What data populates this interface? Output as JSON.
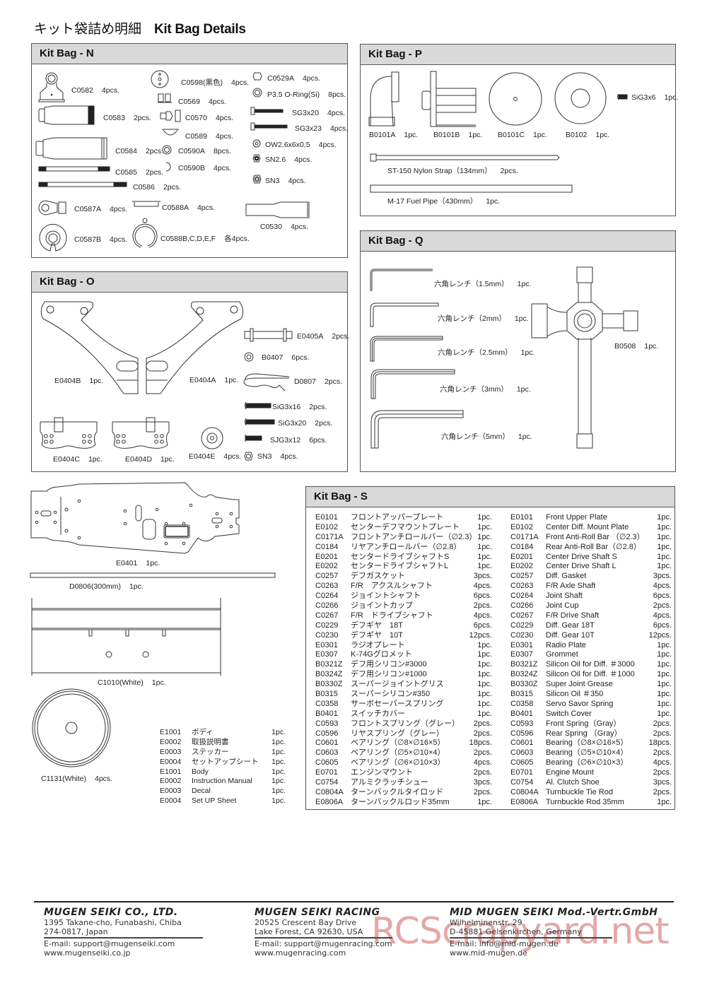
{
  "page": {
    "title_ja": "キット袋詰め明細",
    "title_en": "Kit Bag Details"
  },
  "bag_n": {
    "title": "Kit  Bag - N",
    "items": [
      {
        "code": "C0582",
        "qty": "4pcs."
      },
      {
        "code": "C0583",
        "qty": "2pcs."
      },
      {
        "code": "C0584",
        "qty": "2pcs."
      },
      {
        "code": "C0585",
        "qty": "2pcs."
      },
      {
        "code": "C0586",
        "qty": "2pcs."
      },
      {
        "code": "C0587A",
        "qty": "4pcs."
      },
      {
        "code": "C0587B",
        "qty": "4pcs."
      },
      {
        "code": "C0598(黒色)",
        "qty": "4pcs."
      },
      {
        "code": "C0569",
        "qty": "4pcs."
      },
      {
        "code": "C0570",
        "qty": "4pcs."
      },
      {
        "code": "C0589",
        "qty": "4pcs."
      },
      {
        "code": "C0590A",
        "qty": "8pcs."
      },
      {
        "code": "C0590B",
        "qty": "4pcs."
      },
      {
        "code": "C0588A",
        "qty": "4pcs."
      },
      {
        "code": "C0588B,C,D,E,F",
        "qty": "各4pcs."
      },
      {
        "code": "C0529A",
        "qty": "4pcs."
      },
      {
        "code": "P3.5 O-Ring(Si)",
        "qty": "8pcs."
      },
      {
        "code": "SG3x20",
        "qty": "4pcs."
      },
      {
        "code": "SG3x23",
        "qty": "4pcs."
      },
      {
        "code": "OW2.6x6x0.5",
        "qty": "4pcs."
      },
      {
        "code": "SN2.6",
        "qty": "4pcs."
      },
      {
        "code": "SN3",
        "qty": "4pcs."
      },
      {
        "code": "C0530",
        "qty": "4pcs."
      }
    ]
  },
  "bag_p": {
    "title": "Kit  Bag - P",
    "items": [
      {
        "code": "B0101A",
        "qty": "1pc."
      },
      {
        "code": "B0101B",
        "qty": "1pc."
      },
      {
        "code": "B0101C",
        "qty": "1pc."
      },
      {
        "code": "B0102",
        "qty": "1pc."
      },
      {
        "code": "SiG3x6",
        "qty": "1pc."
      },
      {
        "code": "ST-150 Nylon Strap（134mm）",
        "qty": "2pcs."
      },
      {
        "code": "M-17 Fuel Pipe（430mm）",
        "qty": "1pc."
      }
    ]
  },
  "bag_o": {
    "title": "Kit  Bag - O",
    "items": [
      {
        "code": "E0404B",
        "qty": "1pc."
      },
      {
        "code": "E0404A",
        "qty": "1pc."
      },
      {
        "code": "E0405A",
        "qty": "2pcs."
      },
      {
        "code": "B0407",
        "qty": "6pcs."
      },
      {
        "code": "D0807",
        "qty": "2pcs."
      },
      {
        "code": "SiG3x16",
        "qty": "2pcs."
      },
      {
        "code": "SiG3x20",
        "qty": "2pcs."
      },
      {
        "code": "SJG3x12",
        "qty": "6pcs."
      },
      {
        "code": "E0404C",
        "qty": "1pc."
      },
      {
        "code": "E0404D",
        "qty": "1pc."
      },
      {
        "code": "E0404E",
        "qty": "4pcs."
      },
      {
        "code": "SN3",
        "qty": "4pcs."
      }
    ]
  },
  "bag_q": {
    "title": "Kit  Bag - Q",
    "items": [
      {
        "code": "六角レンチ（1.5mm）",
        "qty": "1pc."
      },
      {
        "code": "六角レンチ（2mm）",
        "qty": "1pc."
      },
      {
        "code": "六角レンチ（2.5mm）",
        "qty": "1pc."
      },
      {
        "code": "六角レンチ（3mm）",
        "qty": "1pc."
      },
      {
        "code": "六角レンチ（5mm）",
        "qty": "1pc."
      },
      {
        "code": "B0508",
        "qty": "1pc."
      }
    ]
  },
  "loose": {
    "items": [
      {
        "code": "E0401",
        "qty": "1pc."
      },
      {
        "code": "D0806(300mm)",
        "qty": "1pc."
      },
      {
        "code": "C1010(White)",
        "qty": "1pc."
      },
      {
        "code": "C1131(White)",
        "qty": "4pcs."
      }
    ],
    "misc_list": [
      {
        "code": "E1001",
        "name": "ボディ",
        "qty": "1pc."
      },
      {
        "code": "E0002",
        "name": "取扱説明書",
        "qty": "1pc."
      },
      {
        "code": "E0003",
        "name": "ステッカー",
        "qty": "1pc."
      },
      {
        "code": "E0004",
        "name": "セットアップシート",
        "qty": "1pc."
      },
      {
        "code": "E1001",
        "name": "Body",
        "qty": "1pc."
      },
      {
        "code": "E0002",
        "name": "Instruction Manual",
        "qty": "1pc."
      },
      {
        "code": "E0003",
        "name": "Decal",
        "qty": "1pc."
      },
      {
        "code": "E0004",
        "name": "Set UP Sheet",
        "qty": "1pc."
      }
    ]
  },
  "bag_s": {
    "title": "Kit  Bag - S",
    "ja": [
      {
        "code": "E0101",
        "name": "フロントアッパープレート",
        "qty": "1pc."
      },
      {
        "code": "E0102",
        "name": "センターデフマウントプレート",
        "qty": "1pc."
      },
      {
        "code": "C0171A",
        "name": "フロントアンチロールバー（∅2.3）",
        "qty": "1pc."
      },
      {
        "code": "C0184",
        "name": "リヤアンチロールバー（∅2.8）",
        "qty": "1pc."
      },
      {
        "code": "E0201",
        "name": "センタードライブシャフトS",
        "qty": "1pc."
      },
      {
        "code": "E0202",
        "name": "センタードライブシャフトL",
        "qty": "1pc."
      },
      {
        "code": "C0257",
        "name": "デフガスケット",
        "qty": "3pcs."
      },
      {
        "code": "C0263",
        "name": "F/R　アクスルシャフト",
        "qty": "4pcs."
      },
      {
        "code": "C0264",
        "name": "ジョイントシャフト",
        "qty": "6pcs."
      },
      {
        "code": "C0266",
        "name": "ジョイントカップ",
        "qty": "2pcs."
      },
      {
        "code": "C0267",
        "name": "F/R　ドライブシャフト",
        "qty": "4pcs."
      },
      {
        "code": "C0229",
        "name": "デフギヤ　18T",
        "qty": "6pcs."
      },
      {
        "code": "C0230",
        "name": "デフギヤ　10T",
        "qty": "12pcs."
      },
      {
        "code": "E0301",
        "name": "ラジオプレート",
        "qty": "1pc."
      },
      {
        "code": "E0307",
        "name": "K-74Gグロメット",
        "qty": "1pc."
      },
      {
        "code": "B0321Z",
        "name": "デフ用シリコン#3000",
        "qty": "1pc."
      },
      {
        "code": "B0324Z",
        "name": "デフ用シリコン#1000",
        "qty": "1pc."
      },
      {
        "code": "B0330Z",
        "name": "スーパージョイントグリス",
        "qty": "1pc."
      },
      {
        "code": "B0315",
        "name": "スーパーシリコン#350",
        "qty": "1pc."
      },
      {
        "code": "C0358",
        "name": "サーボセーバースプリング",
        "qty": "1pc."
      },
      {
        "code": "B0401",
        "name": "スイッチカバー",
        "qty": "1pc."
      },
      {
        "code": "C0593",
        "name": "フロントスプリング（グレー）",
        "qty": "2pcs."
      },
      {
        "code": "C0596",
        "name": "リヤスプリング（グレー）",
        "qty": "2pcs."
      },
      {
        "code": "C0601",
        "name": "ベアリング（∅8×∅16×5）",
        "qty": "18pcs."
      },
      {
        "code": "C0603",
        "name": "ベアリング（∅5×∅10×4）",
        "qty": "2pcs."
      },
      {
        "code": "C0605",
        "name": "ベアリング（∅6×∅10×3）",
        "qty": "4pcs."
      },
      {
        "code": "E0701",
        "name": "エンジンマウント",
        "qty": "2pcs."
      },
      {
        "code": "C0754",
        "name": "アルミクラッチシュー",
        "qty": "3pcs."
      },
      {
        "code": "C0804A",
        "name": "ターンバックルタイロッド",
        "qty": "2pcs."
      },
      {
        "code": "E0806A",
        "name": "ターンバックルロッド35mm",
        "qty": "1pc."
      }
    ],
    "en": [
      {
        "code": "E0101",
        "name": "Front Upper Plate",
        "qty": "1pc."
      },
      {
        "code": "E0102",
        "name": "Center Diff. Mount Plate",
        "qty": "1pc."
      },
      {
        "code": "C0171A",
        "name": "Front Anti-Roll Bar （∅2.3）",
        "qty": "1pc."
      },
      {
        "code": "C0184",
        "name": "Rear Anti-Roll Bar（∅2.8）",
        "qty": "1pc."
      },
      {
        "code": "E0201",
        "name": "Center Drive Shaft S",
        "qty": "1pc."
      },
      {
        "code": "E0202",
        "name": "Center Drive Shaft L",
        "qty": "1pc."
      },
      {
        "code": "C0257",
        "name": "Diff. Gasket",
        "qty": "3pcs."
      },
      {
        "code": "C0263",
        "name": "F/R Axle Shaft",
        "qty": "4pcs."
      },
      {
        "code": "C0264",
        "name": "Joint Shaft",
        "qty": "6pcs."
      },
      {
        "code": "C0266",
        "name": "Joint Cup",
        "qty": "2pcs."
      },
      {
        "code": "C0267",
        "name": "F/R Drive Shaft",
        "qty": "4pcs."
      },
      {
        "code": "C0229",
        "name": "Diff. Gear 18T",
        "qty": "6pcs."
      },
      {
        "code": "C0230",
        "name": "Diff. Gear 10T",
        "qty": "12pcs."
      },
      {
        "code": "E0301",
        "name": "Radio Plate",
        "qty": "1pc."
      },
      {
        "code": "E0307",
        "name": "Grommet",
        "qty": "1pc."
      },
      {
        "code": "B0321Z",
        "name": "Silicon Oil for Diff. ＃3000",
        "qty": "1pc."
      },
      {
        "code": "B0324Z",
        "name": "Silicon Oil for Diff. ＃1000",
        "qty": "1pc."
      },
      {
        "code": "B0330Z",
        "name": "Super Joint Grease",
        "qty": "1pc."
      },
      {
        "code": "B0315",
        "name": "Silicon Oil ＃350",
        "qty": "1pc."
      },
      {
        "code": "C0358",
        "name": "Servo Savor Spring",
        "qty": "1pc."
      },
      {
        "code": "B0401",
        "name": "Switch Cover",
        "qty": "1pc."
      },
      {
        "code": "C0593",
        "name": "Front Spring（Gray）",
        "qty": "2pcs."
      },
      {
        "code": "C0596",
        "name": "Rear Spring （Gray）",
        "qty": "2pcs."
      },
      {
        "code": "C0601",
        "name": "Bearing（∅8×∅16×5）",
        "qty": "18pcs."
      },
      {
        "code": "C0603",
        "name": "Bearing（∅5×∅10×4）",
        "qty": "2pcs."
      },
      {
        "code": "C0605",
        "name": "Bearing（∅6×∅10×3）",
        "qty": "4pcs."
      },
      {
        "code": "E0701",
        "name": "Engine Mount",
        "qty": "2pcs."
      },
      {
        "code": "C0754",
        "name": "Al. Clutch Shoe",
        "qty": "3pcs."
      },
      {
        "code": "C0804A",
        "name": "Turnbuckle Tie Rod",
        "qty": "2pcs."
      },
      {
        "code": "E0806A",
        "name": "Turnbuckle Rod 35mm",
        "qty": "1pc."
      }
    ]
  },
  "footer": {
    "companies": [
      {
        "name": "MUGEN SEIKI CO., LTD.",
        "addr1": "1395 Takane-cho, Funabashi, Chiba",
        "addr2": "274-0817, Japan",
        "email": "E-mail: support@mugenseiki.com",
        "web": "www.mugenseiki.co.jp"
      },
      {
        "name": "MUGEN SEIKI RACING",
        "addr1": "20525 Crescent Bay Drive",
        "addr2": "Lake Forest, CA 92630, USA",
        "email": "E-mail: support@mugenracing.com",
        "web": "www.mugenracing.com"
      },
      {
        "name": "MID MUGEN SEIKI Mod.-Vertr.GmbH",
        "addr1": "Wilhelminenstr. 29",
        "addr2": "D-45881 Gelsenkirchen, Germany",
        "email": "E-mail: info@mid-mugen.de",
        "web": "www.mid-mugen.de"
      }
    ],
    "watermark": "RCScrapyard.net"
  }
}
